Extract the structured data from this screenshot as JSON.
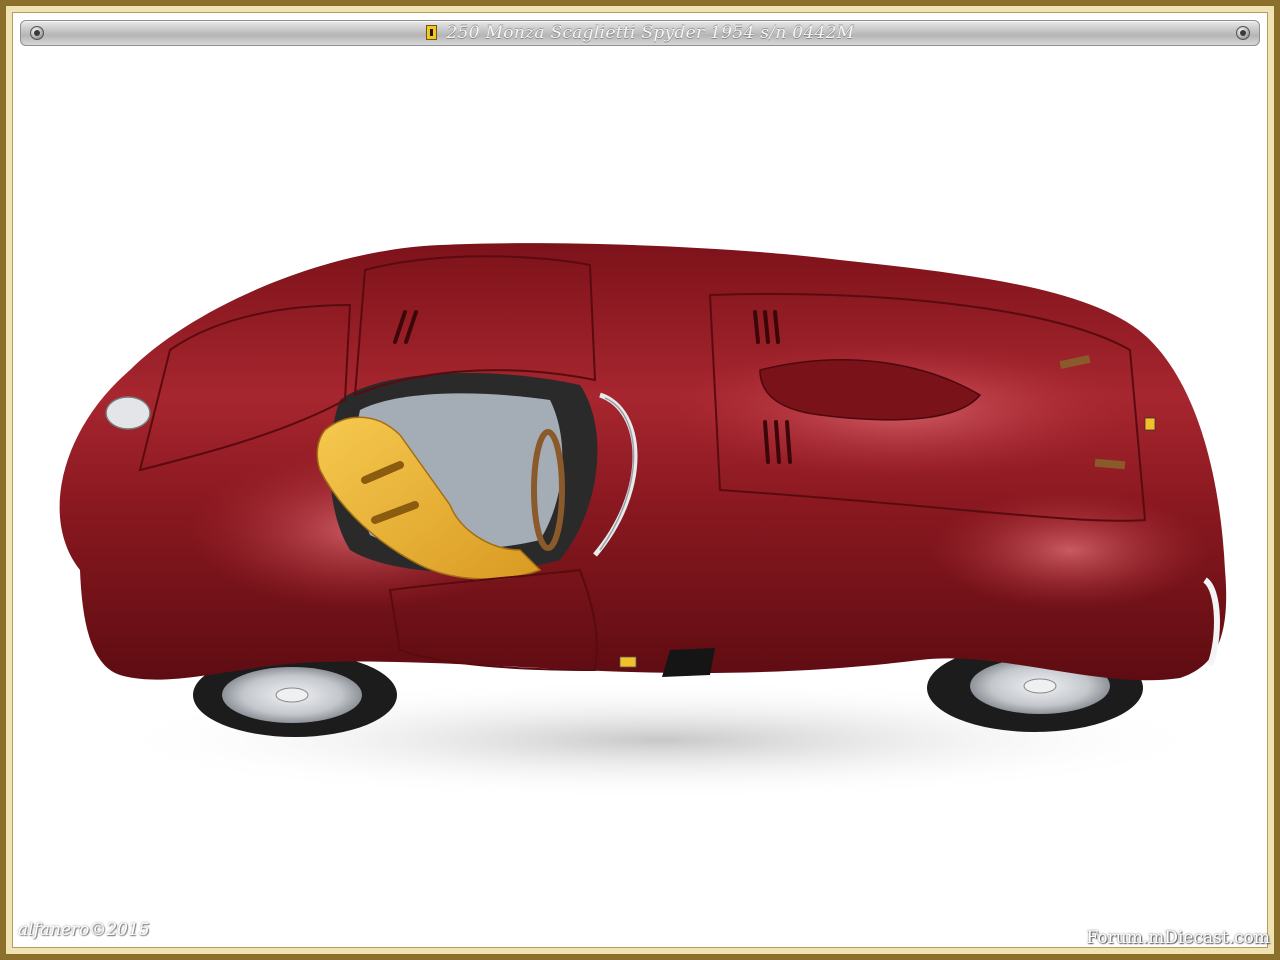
{
  "title": "250 Monza Scaglietti Spyder 1954  s/n 0442M",
  "credit": "alfanero©2015",
  "site_mark": "Forum.mDiecast.com",
  "colors": {
    "frame_gold": "#8b6f2a",
    "frame_cream": "#efe3b3",
    "car_body": "#8e1a22",
    "car_highlight": "#c4404a",
    "seat_yellow": "#f2b83a",
    "tire": "#1c1c1c",
    "wheel_silver": "#c9cdd2"
  },
  "icons": [
    "ferrari-badge-icon",
    "screw-bolt-icon"
  ]
}
